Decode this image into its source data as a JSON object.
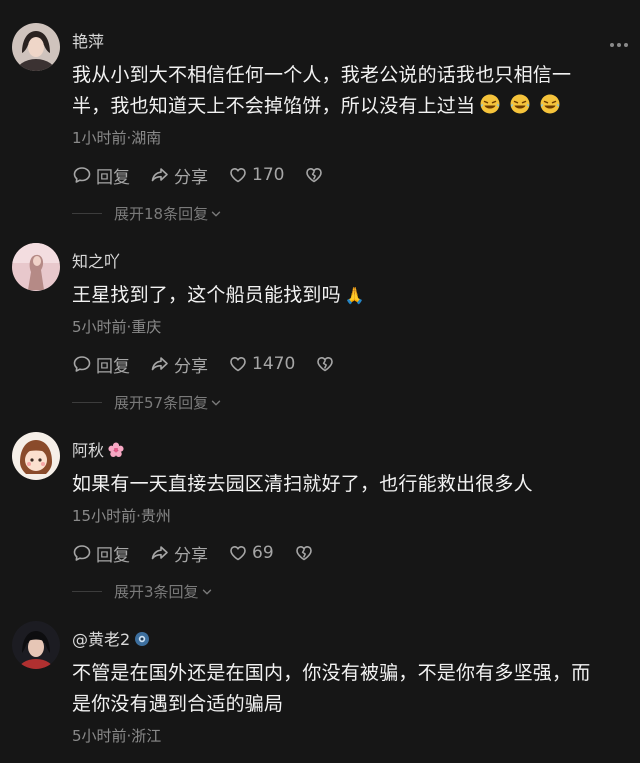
{
  "comments": [
    {
      "username": "艳萍",
      "text_line1": "我从小到大不相信任何一个人，我老公说的话我也只相信一",
      "text_line2": "半，我也知道天上不会掉馅饼，所以没有上过当",
      "emoji_icons": [
        "rolling-laughing-icon",
        "rolling-laughing-icon",
        "rolling-laughing-icon"
      ],
      "meta": "1小时前·湖南",
      "reply_label": "回复",
      "share_label": "分享",
      "like_count": "170",
      "expand_label": "展开18条回复"
    },
    {
      "username": "知之吖",
      "text_line1": "王星找到了，这个船员能找到吗",
      "emoji_icons": [
        "folded-hands-icon"
      ],
      "meta": "5小时前·重庆",
      "reply_label": "回复",
      "share_label": "分享",
      "like_count": "1470",
      "expand_label": "展开57条回复"
    },
    {
      "username": "阿秋",
      "username_icon": "cherry-blossom-icon",
      "text_line1": "如果有一天直接去园区清扫就好了，也行能救出很多人",
      "meta": "15小时前·贵州",
      "reply_label": "回复",
      "share_label": "分享",
      "like_count": "69",
      "expand_label": "展开3条回复"
    },
    {
      "username": "@黄老2",
      "username_icon": "camera-badge-icon",
      "text_line1": "不管是在国外还是在国内，你没有被骗，不是你有多坚强，而",
      "text_line2": "是你没有遇到合适的骗局",
      "meta": "5小时前·浙江"
    }
  ],
  "colors": {
    "background": "#161616",
    "text": "#f2f2f2",
    "username": "#d9d9d9",
    "meta": "#8a8a8a"
  }
}
